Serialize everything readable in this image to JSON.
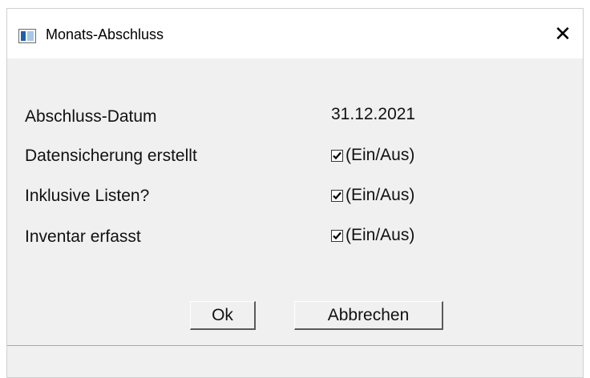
{
  "window": {
    "title": "Monats-Abschluss",
    "close_glyph": "✕",
    "icon": "app-window-icon"
  },
  "form": {
    "date_label": "Abschluss-Datum",
    "date_value": "31.12.2021",
    "rows": [
      {
        "label": "Datensicherung erstellt",
        "checked": true,
        "option_text": "(Ein/Aus)"
      },
      {
        "label": "Inklusive Listen?",
        "checked": true,
        "option_text": "(Ein/Aus)"
      },
      {
        "label": "Inventar erfasst",
        "checked": true,
        "option_text": "(Ein/Aus)"
      }
    ]
  },
  "buttons": {
    "ok_label": "Ok",
    "cancel_label": "Abbrechen"
  },
  "status": {
    "text": ""
  }
}
